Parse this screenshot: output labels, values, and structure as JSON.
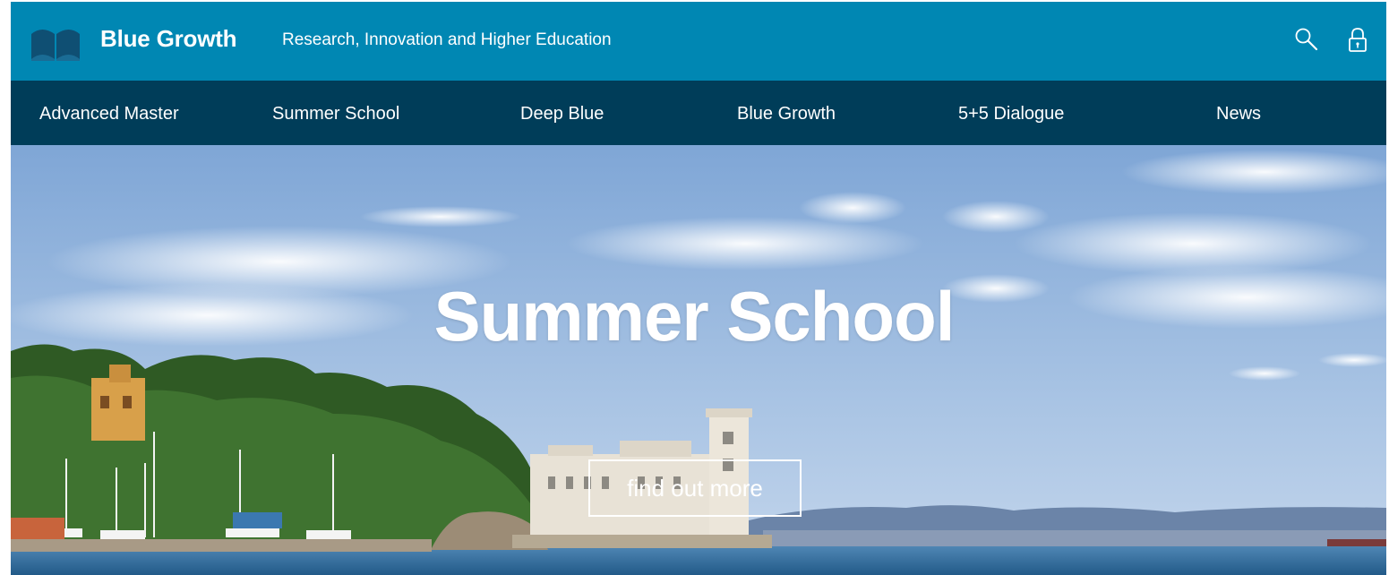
{
  "header": {
    "brand": "Blue Growth",
    "tagline": "Research, Innovation and Higher Education",
    "logo_icon": "open-book-logo-icon",
    "search_icon": "search-icon",
    "login_icon": "lock-icon"
  },
  "nav": {
    "items": [
      {
        "label": "Advanced Master"
      },
      {
        "label": "Summer School"
      },
      {
        "label": "Deep Blue"
      },
      {
        "label": "Blue Growth"
      },
      {
        "label": "5+5 Dialogue"
      },
      {
        "label": "News"
      }
    ]
  },
  "hero": {
    "title": "Summer School",
    "cta_label": "find out more",
    "image_subject": "seaside-castle-photo"
  },
  "colors": {
    "topbar": "#0087b3",
    "navbar": "#003d59",
    "text": "#ffffff",
    "sky": "#8fb3d9",
    "sea": "#2f6b9a"
  }
}
